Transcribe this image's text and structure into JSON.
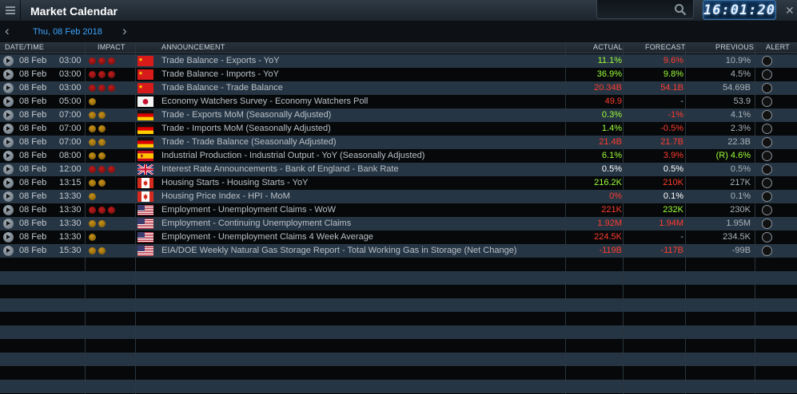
{
  "window": {
    "title": "Market Calendar",
    "clock": "16:01:20"
  },
  "datebar": {
    "date": "Thu, 08 Feb 2018"
  },
  "headers": {
    "datetime": "DATE/TIME",
    "impact": "IMPACT",
    "announcement": "ANNOUNCEMENT",
    "actual": "ACTUAL",
    "forecast": "FORECAST",
    "previous": "PREVIOUS",
    "alert": "ALERT"
  },
  "colors": {
    "impact_high": "#c01b1b",
    "impact_medium": "#c8921a",
    "positive": "#9dff3a",
    "negative": "#ff3b2f",
    "date_accent": "#3ba3ff"
  },
  "rows": [
    {
      "date": "08 Feb",
      "time": "03:00",
      "impact": 3,
      "country": "china-flag",
      "announcement": "Trade Balance - Exports - YoY",
      "actual": "11.1%",
      "actual_tone": "pos",
      "forecast": "9.6%",
      "forecast_tone": "neg",
      "previous": "10.9%",
      "previous_tone": "dim"
    },
    {
      "date": "08 Feb",
      "time": "03:00",
      "impact": 3,
      "country": "china-flag",
      "announcement": "Trade Balance - Imports - YoY",
      "actual": "36.9%",
      "actual_tone": "pos",
      "forecast": "9.8%",
      "forecast_tone": "pos",
      "previous": "4.5%",
      "previous_tone": "dim"
    },
    {
      "date": "08 Feb",
      "time": "03:00",
      "impact": 3,
      "country": "china-flag",
      "announcement": "Trade Balance - Trade Balance",
      "actual": "20.34B",
      "actual_tone": "neg",
      "forecast": "54.1B",
      "forecast_tone": "neg",
      "previous": "54.69B",
      "previous_tone": "dim"
    },
    {
      "date": "08 Feb",
      "time": "05:00",
      "impact": 1,
      "country": "japan-flag",
      "announcement": "Economy Watchers Survey - Economy Watchers Poll",
      "actual": "49.9",
      "actual_tone": "neg",
      "forecast": "-",
      "forecast_tone": "dim",
      "previous": "53.9",
      "previous_tone": "dim"
    },
    {
      "date": "08 Feb",
      "time": "07:00",
      "impact": 2,
      "country": "germany-flag",
      "announcement": "Trade - Exports MoM (Seasonally Adjusted)",
      "actual": "0.3%",
      "actual_tone": "pos",
      "forecast": "-1%",
      "forecast_tone": "neg",
      "previous": "4.1%",
      "previous_tone": "dim"
    },
    {
      "date": "08 Feb",
      "time": "07:00",
      "impact": 2,
      "country": "germany-flag",
      "announcement": "Trade - Imports MoM (Seasonally Adjusted)",
      "actual": "1.4%",
      "actual_tone": "pos",
      "forecast": "-0.5%",
      "forecast_tone": "neg",
      "previous": "2.3%",
      "previous_tone": "dim"
    },
    {
      "date": "08 Feb",
      "time": "07:00",
      "impact": 2,
      "country": "germany-flag",
      "announcement": "Trade - Trade Balance (Seasonally Adjusted)",
      "actual": "21.4B",
      "actual_tone": "neg",
      "forecast": "21.7B",
      "forecast_tone": "neg",
      "previous": "22.3B",
      "previous_tone": "dim"
    },
    {
      "date": "08 Feb",
      "time": "08:00",
      "impact": 2,
      "country": "spain-flag",
      "announcement": "Industrial Production - Industrial Output - YoY (Seasonally Adjusted)",
      "actual": "6.1%",
      "actual_tone": "pos",
      "forecast": "3.9%",
      "forecast_tone": "neg",
      "previous": "(R) 4.6%",
      "previous_tone": "pos"
    },
    {
      "date": "08 Feb",
      "time": "12:00",
      "impact": 3,
      "country": "uk-flag",
      "announcement": "Interest Rate Announcements - Bank of England - Bank Rate",
      "actual": "0.5%",
      "actual_tone": "neu",
      "forecast": "0.5%",
      "forecast_tone": "neu",
      "previous": "0.5%",
      "previous_tone": "dim"
    },
    {
      "date": "08 Feb",
      "time": "13:15",
      "impact": 2,
      "country": "canada-flag",
      "announcement": "Housing Starts - Housing Starts - YoY",
      "actual": "216.2K",
      "actual_tone": "pos",
      "forecast": "210K",
      "forecast_tone": "neg",
      "previous": "217K",
      "previous_tone": "dim"
    },
    {
      "date": "08 Feb",
      "time": "13:30",
      "impact": 1,
      "country": "canada-flag",
      "announcement": "Housing Price Index - HPI - MoM",
      "actual": "0%",
      "actual_tone": "neg",
      "forecast": "0.1%",
      "forecast_tone": "neu",
      "previous": "0.1%",
      "previous_tone": "dim"
    },
    {
      "date": "08 Feb",
      "time": "13:30",
      "impact": 3,
      "country": "usa-flag",
      "announcement": "Employment - Unemployment Claims - WoW",
      "actual": "221K",
      "actual_tone": "neg",
      "forecast": "232K",
      "forecast_tone": "pos",
      "previous": "230K",
      "previous_tone": "dim"
    },
    {
      "date": "08 Feb",
      "time": "13:30",
      "impact": 2,
      "country": "usa-flag",
      "announcement": "Employment - Continuing Unemployment Claims",
      "actual": "1.92M",
      "actual_tone": "neg",
      "forecast": "1.94M",
      "forecast_tone": "neg",
      "previous": "1.95M",
      "previous_tone": "dim"
    },
    {
      "date": "08 Feb",
      "time": "13:30",
      "impact": 1,
      "country": "usa-flag",
      "announcement": "Employment - Unemployment Claims 4 Week Average",
      "actual": "224.5K",
      "actual_tone": "neg",
      "forecast": "-",
      "forecast_tone": "dim",
      "previous": "234.5K",
      "previous_tone": "dim"
    },
    {
      "date": "08 Feb",
      "time": "15:30",
      "impact": 2,
      "country": "usa-flag",
      "announcement": "EIA/DOE Weekly Natural Gas Storage Report - Total Working Gas in Storage (Net Change)",
      "actual": "-119B",
      "actual_tone": "neg",
      "forecast": "-117B",
      "forecast_tone": "neg",
      "previous": "-99B",
      "previous_tone": "dim"
    }
  ]
}
